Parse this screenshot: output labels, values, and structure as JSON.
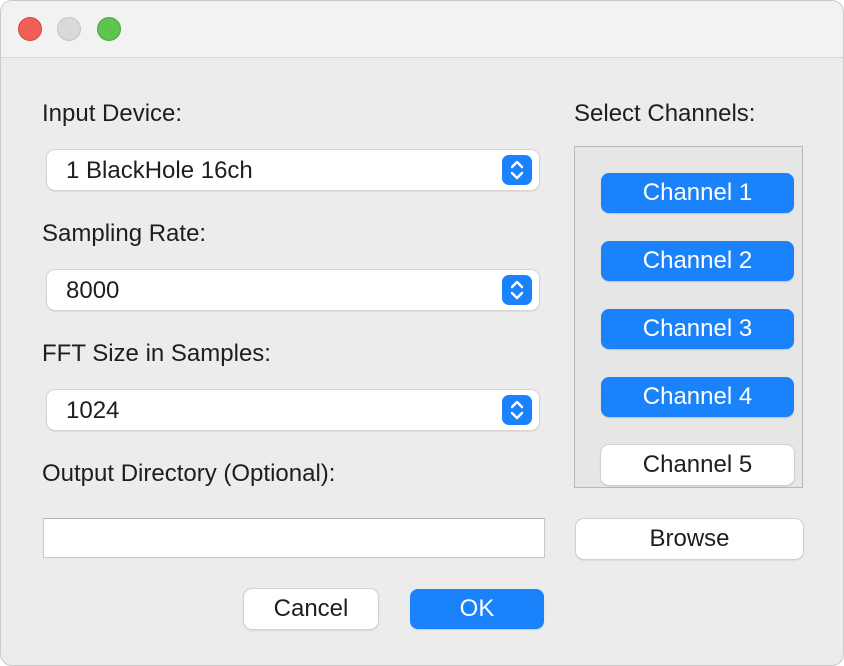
{
  "window": {
    "controls": [
      "close",
      "minimize",
      "zoom"
    ]
  },
  "form": {
    "input_device": {
      "label": "Input Device:",
      "value": "1 BlackHole 16ch"
    },
    "sampling_rate": {
      "label": "Sampling Rate:",
      "value": "8000"
    },
    "fft_size": {
      "label": "FFT Size in Samples:",
      "value": "1024"
    },
    "output_directory": {
      "label": "Output Directory (Optional):",
      "value": "",
      "placeholder": ""
    }
  },
  "channels": {
    "label": "Select Channels:",
    "items": [
      {
        "label": "Channel 1",
        "selected": true
      },
      {
        "label": "Channel 2",
        "selected": true
      },
      {
        "label": "Channel 3",
        "selected": true
      },
      {
        "label": "Channel 4",
        "selected": true
      },
      {
        "label": "Channel 5",
        "selected": false
      }
    ]
  },
  "buttons": {
    "browse": "Browse",
    "cancel": "Cancel",
    "ok": "OK"
  },
  "colors": {
    "accent": "#1a82fb",
    "window_bg": "#ececec",
    "close": "#ee5f57",
    "minimize": "#d9d9d9",
    "zoom": "#5ec34f"
  }
}
